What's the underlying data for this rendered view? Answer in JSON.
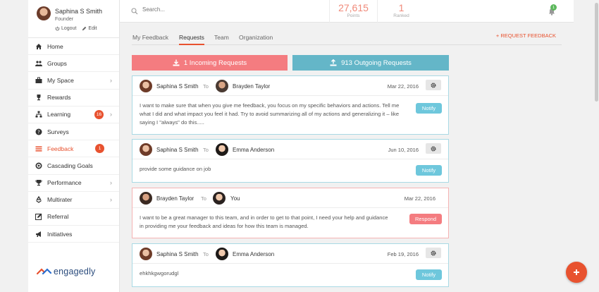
{
  "user": {
    "name": "Saphina S Smith",
    "role": "Founder",
    "logout": "Logout",
    "edit": "Edit"
  },
  "search": {
    "placeholder": "Search..."
  },
  "stats": [
    {
      "value": "27,615",
      "label": "Points"
    },
    {
      "value": "1",
      "label": "Ranked"
    }
  ],
  "notifications": {
    "count": "1"
  },
  "sidebar": {
    "items": [
      {
        "label": "Home",
        "icon": "home-icon"
      },
      {
        "label": "Groups",
        "icon": "users-icon"
      },
      {
        "label": "My Space",
        "icon": "briefcase-icon"
      },
      {
        "label": "Rewards",
        "icon": "trophy-icon"
      },
      {
        "label": "Learning",
        "icon": "sitemap-icon",
        "badge": "16"
      },
      {
        "label": "Surveys",
        "icon": "question-icon"
      },
      {
        "label": "Feedback",
        "icon": "list-icon",
        "badge": "1"
      },
      {
        "label": "Cascading Goals",
        "icon": "target-icon"
      },
      {
        "label": "Performance",
        "icon": "cup-icon"
      },
      {
        "label": "Multirater",
        "icon": "recycle-icon"
      },
      {
        "label": "Referral",
        "icon": "edit-icon"
      },
      {
        "label": "Initiatives",
        "icon": "megaphone-icon"
      }
    ]
  },
  "logo": {
    "text": "engagedly"
  },
  "tabs": [
    "My Feedback",
    "Requests",
    "Team",
    "Organization"
  ],
  "request_feedback": "+ REQUEST FEEDBACK",
  "incoming": "1 Incoming Requests",
  "outgoing": "913 Outgoing Requests",
  "cards": [
    {
      "from": "Saphina S Smith",
      "to_label": "To",
      "to": "Brayden Taylor",
      "date": "Mar 22, 2016",
      "text": "I want to make sure that when you give me feedback, you focus on my specific behaviors and actions.  Tell me what I did and what impact you feel it had.  Try to avoid summarizing all of my actions and generalizing it – like saying I \"always\" do this.....",
      "action": "Notify"
    },
    {
      "from": "Saphina S Smith",
      "to_label": "To",
      "to": "Emma Anderson",
      "date": "Jun 10, 2016",
      "text": "provide some guidance on job",
      "action": "Notify"
    },
    {
      "from": "Brayden Taylor",
      "to_label": "To",
      "to": "You",
      "date": "Mar 22, 2016",
      "text": "I want to be a great manager to this team, and in order to get to that point, I need your help and guidance in providing me your feedback and ideas for how this team is managed.",
      "action": "Respond"
    },
    {
      "from": "Saphina S Smith",
      "to_label": "To",
      "to": "Emma Anderson",
      "date": "Feb 19, 2016",
      "text": "ehkhkgwgorudgl",
      "action": "Notify"
    }
  ],
  "colors": {
    "accent": "#e8522f",
    "incoming": "#f47c80",
    "outgoing": "#64b6c8",
    "notify": "#6ec7dc"
  }
}
